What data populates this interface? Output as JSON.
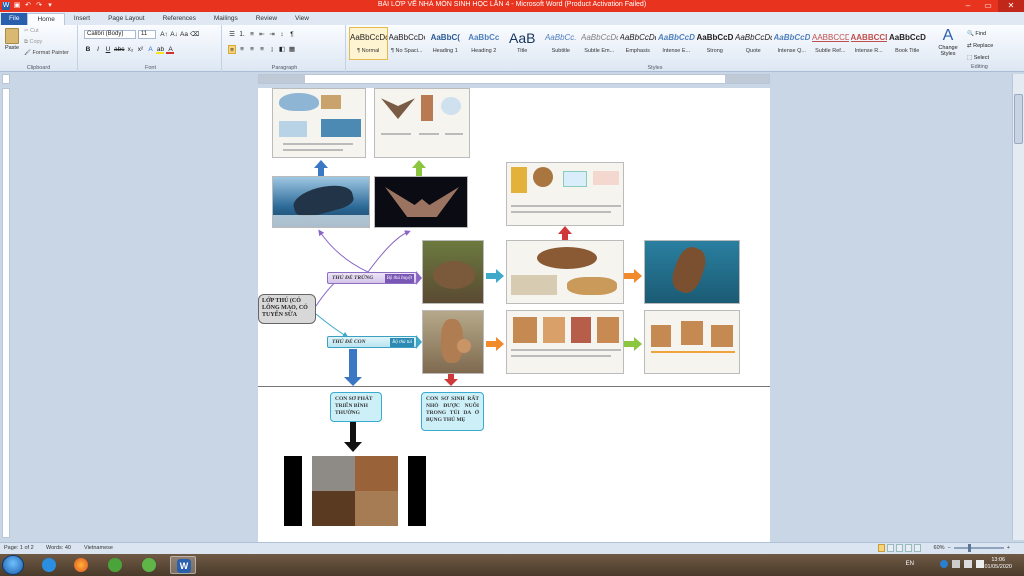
{
  "window": {
    "title": "BÀI LỚP VỀ NHÀ MÔN SINH HỌC LẦN 4 - Microsoft Word (Product Activation Failed)",
    "minimize": "–",
    "maximize": "▭",
    "close": "✕"
  },
  "tabs": [
    "File",
    "Home",
    "Insert",
    "Page Layout",
    "References",
    "Mailings",
    "Review",
    "View"
  ],
  "ribbon": {
    "clipboard": {
      "paste": "Paste",
      "cut": "Cut",
      "copy": "Copy",
      "format_painter": "Format Painter",
      "label": "Clipboard"
    },
    "font": {
      "name": "Calibri (Body)",
      "size": "11",
      "label": "Font"
    },
    "paragraph": {
      "label": "Paragraph"
    },
    "styles": {
      "label": "Styles",
      "items": [
        {
          "preview": "AaBbCcDc",
          "name": "¶ Normal"
        },
        {
          "preview": "AaBbCcDc",
          "name": "¶ No Spaci..."
        },
        {
          "preview": "AaBbC(",
          "name": "Heading 1"
        },
        {
          "preview": "AaBbCc",
          "name": "Heading 2"
        },
        {
          "preview": "AaB",
          "name": "Title"
        },
        {
          "preview": "AaBbCc.",
          "name": "Subtitle"
        },
        {
          "preview": "AaBbCcDc",
          "name": "Subtle Em..."
        },
        {
          "preview": "AaBbCcDc",
          "name": "Emphasis"
        },
        {
          "preview": "AaBbCcDc",
          "name": "Intense E..."
        },
        {
          "preview": "AaBbCcDc",
          "name": "Strong"
        },
        {
          "preview": "AaBbCcDc",
          "name": "Quote"
        },
        {
          "preview": "AaBbCcDc",
          "name": "Intense Q..."
        },
        {
          "preview": "AABBCCDE",
          "name": "Subtle Ref..."
        },
        {
          "preview": "AABBCCDE",
          "name": "Intense R..."
        },
        {
          "preview": "AaBbCcDC",
          "name": "Book Title"
        }
      ],
      "change_styles": "Change Styles"
    },
    "editing": {
      "label": "Editing",
      "find": "Find",
      "replace": "Replace",
      "select": "Select"
    }
  },
  "document": {
    "root_node": "LỚP THÚ (CÓ LÔNG MAO, CÓ TUYẾN SỮA",
    "egg_branch": {
      "title": "THÚ ĐẺ TRỨNG",
      "sample": "Bộ thú huyệt"
    },
    "live_branch": {
      "title": "THÚ ĐẺ CON",
      "sample": "Bộ thú túi"
    },
    "callout_placental": "CON SƠ PHÁT TRIỂN BÌNH THƯỜNG",
    "callout_marsupial": "CON SƠ SINH RẤT NHỎ ĐƯỢC NUÔI TRONG TÚI DA Ở BỤNG THÚ MẸ"
  },
  "statusbar": {
    "page": "Page: 1 of 2",
    "words": "Words: 40",
    "language": "Vietnamese",
    "zoom": "60%",
    "zoom_value": 0.6
  },
  "taskbar": {
    "lang": "EN",
    "time": "13:06",
    "date": "01/05/2020"
  },
  "colors": {
    "titlebar": "#e8341f",
    "file_tab": "#2a5fae",
    "arrow_blue": "#3a78c4",
    "arrow_purple": "#8a66c6",
    "arrow_teal": "#3fa9c9",
    "arrow_orange": "#f08a2a",
    "arrow_green": "#8cc63f",
    "arrow_red": "#d0393a"
  }
}
